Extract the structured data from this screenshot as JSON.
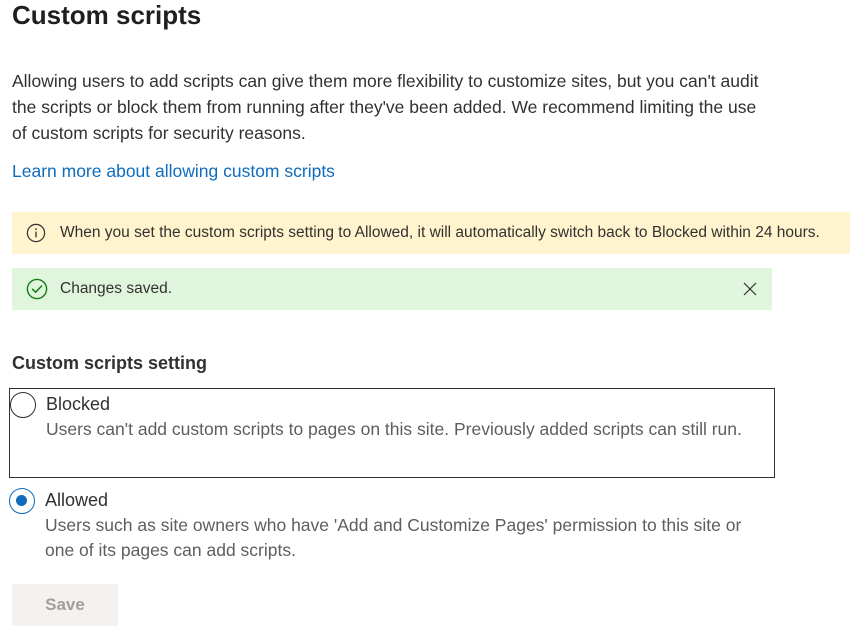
{
  "title": "Custom scripts",
  "description": "Allowing users to add scripts can give them more flexibility to customize sites, but you can't audit the scripts or block them from running after they've been added. We recommend limiting the use of custom scripts for security reasons.",
  "learn_more_link": "Learn more about allowing custom scripts",
  "info_bar": {
    "icon": "info-icon",
    "text": "When you set the custom scripts setting to Allowed, it will automatically switch back to Blocked within 24 hours.",
    "color": "#fff4ce"
  },
  "success_bar": {
    "icon": "checkmark-circle-icon",
    "text": "Changes saved.",
    "dismiss_icon": "close-icon",
    "color": "#dff6dd"
  },
  "setting": {
    "label": "Custom scripts setting",
    "selected": "Allowed",
    "options": [
      {
        "title": "Blocked",
        "description": "Users can't add custom scripts to pages on this site. Previously added scripts can still run.",
        "checked": false
      },
      {
        "title": "Allowed",
        "description": "Users such as site owners who have 'Add and Customize Pages' permission to this site or one of its pages can add scripts.",
        "checked": true
      }
    ]
  },
  "save_button": {
    "label": "Save",
    "disabled": true
  },
  "colors": {
    "accent": "#0f6cbd",
    "text": "#323130",
    "disabled_text": "#a19f9d"
  }
}
